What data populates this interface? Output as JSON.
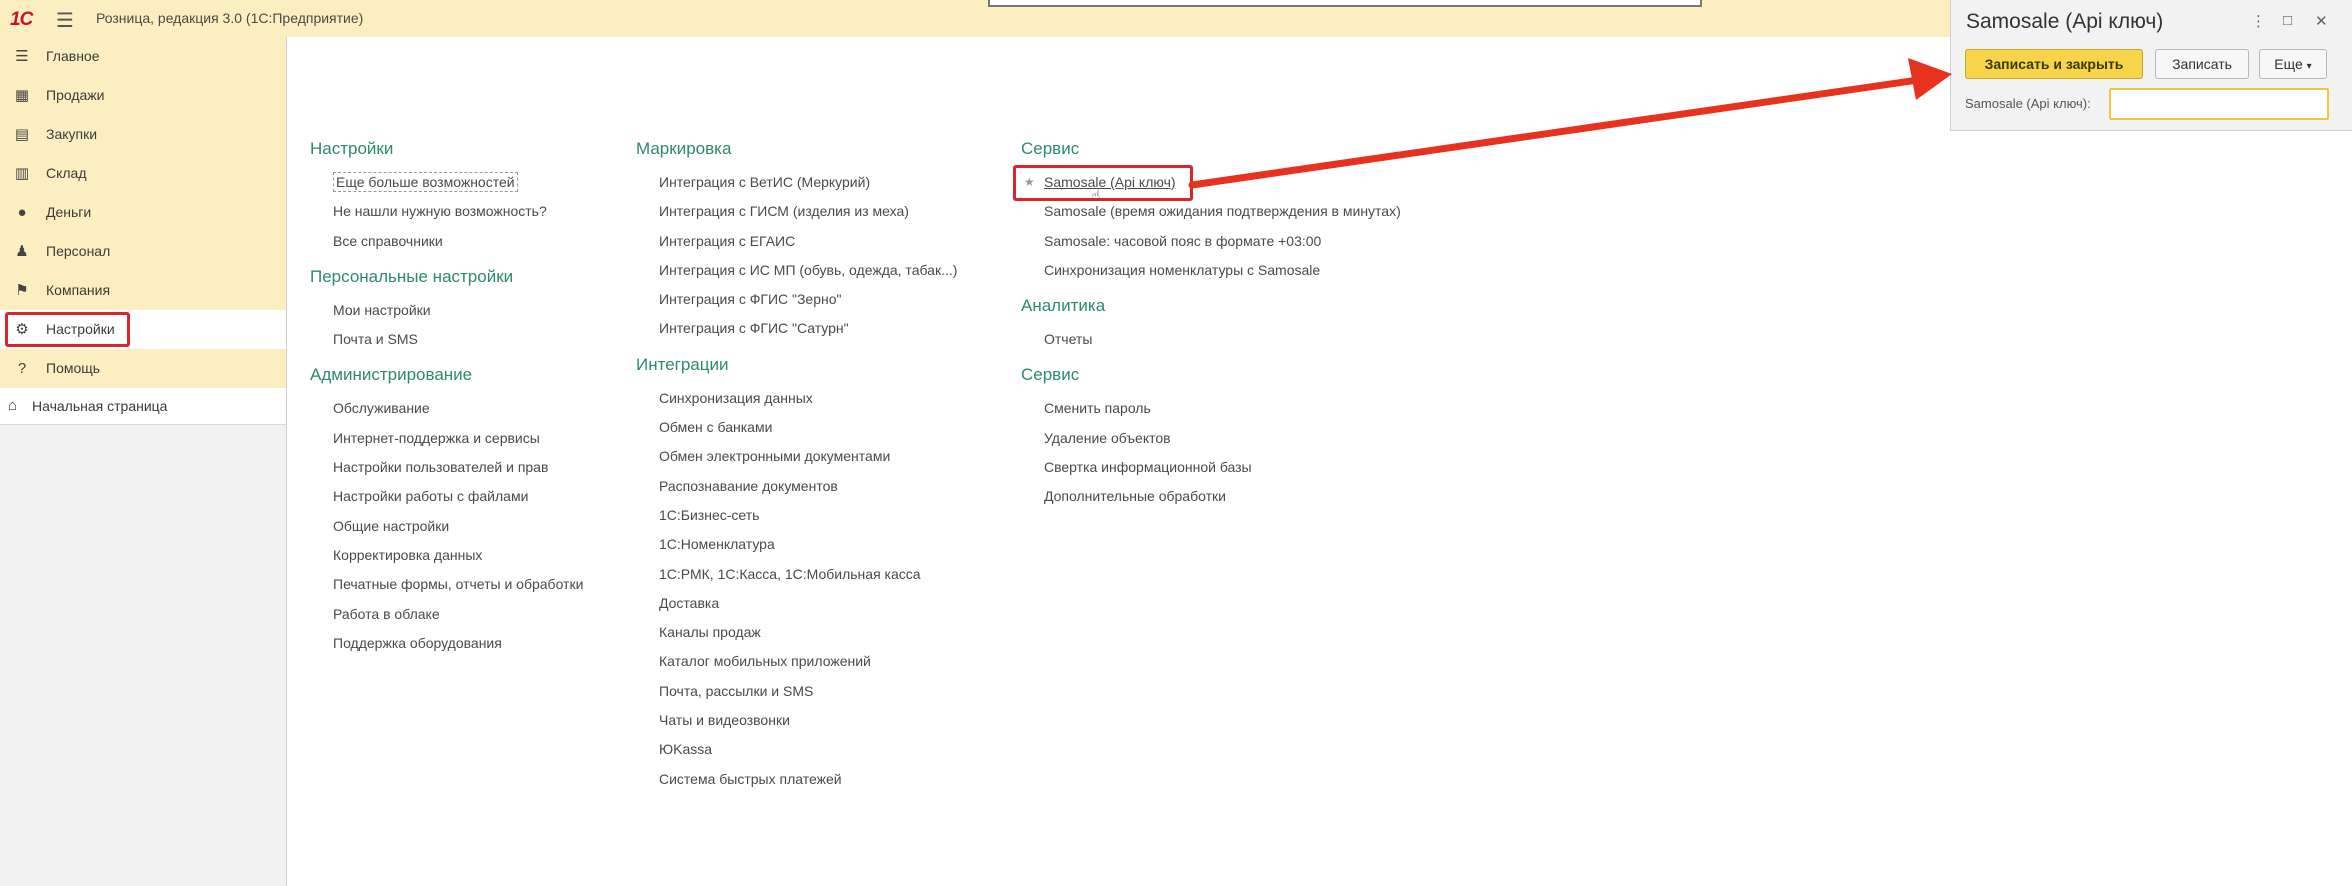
{
  "titlebar": {
    "logo": "1С",
    "menu_icon": "hamburger-icon",
    "title": "Розница, редакция 3.0  (1С:Предприятие)"
  },
  "sidebar": {
    "items": [
      {
        "label": "Главное",
        "icon": "list-icon"
      },
      {
        "label": "Продажи",
        "icon": "cash-register-icon"
      },
      {
        "label": "Закупки",
        "icon": "cart-icon"
      },
      {
        "label": "Склад",
        "icon": "warehouse-icon"
      },
      {
        "label": "Деньги",
        "icon": "coin-icon"
      },
      {
        "label": "Персонал",
        "icon": "people-icon"
      },
      {
        "label": "Компания",
        "icon": "flag-icon"
      },
      {
        "label": "Настройки",
        "icon": "gear-icon"
      },
      {
        "label": "Помощь",
        "icon": "help-icon"
      }
    ],
    "home": {
      "label": "Начальная страница",
      "icon": "home-icon"
    }
  },
  "main": {
    "col1": {
      "g1": {
        "title": "Настройки",
        "links": [
          "Еще больше возможностей",
          "Не нашли нужную возможность?",
          "Все справочники"
        ]
      },
      "g2": {
        "title": "Персональные настройки",
        "links": [
          "Мои настройки",
          "Почта и SMS"
        ]
      },
      "g3": {
        "title": "Администрирование",
        "links": [
          "Обслуживание",
          "Интернет-поддержка и сервисы",
          "Настройки пользователей и прав",
          "Настройки работы с файлами",
          "Общие настройки",
          "Корректировка данных",
          "Печатные формы, отчеты и обработки",
          "Работа в облаке",
          "Поддержка оборудования"
        ]
      }
    },
    "col2": {
      "g1": {
        "title": "Маркировка",
        "links": [
          "Интеграция с ВетИС (Меркурий)",
          "Интеграция с ГИСМ (изделия из меха)",
          "Интеграция с ЕГАИС",
          "Интеграция с ИС МП (обувь, одежда, табак...)",
          "Интеграция с ФГИС \"Зерно\"",
          "Интеграция с ФГИС \"Сатурн\""
        ]
      },
      "g2": {
        "title": "Интеграции",
        "links": [
          "Синхронизация данных",
          "Обмен с банками",
          "Обмен электронными документами",
          "Распознавание документов",
          "1С:Бизнес-сеть",
          "1С:Номенклатура",
          "1С:РМК, 1С:Касса, 1С:Мобильная касса",
          "Доставка",
          "Каналы продаж",
          "Каталог мобильных приложений",
          "Почта, рассылки и SMS",
          "Чаты и видеозвонки",
          "ЮKassa",
          "Система быстрых платежей"
        ]
      }
    },
    "col3": {
      "g1": {
        "title": "Сервис",
        "links": [
          "Samosale (Api ключ)",
          "Samosale (время ожидания подтверждения в минутах)",
          "Samosale: часовой пояс в формате +03:00",
          "Синхронизация номенклатуры с Samosale"
        ]
      },
      "g2": {
        "title": "Аналитика",
        "links": [
          "Отчеты"
        ]
      },
      "g3": {
        "title": "Сервис",
        "links": [
          "Сменить пароль",
          "Удаление объектов",
          "Свертка информационной базы",
          "Дополнительные обработки"
        ]
      }
    }
  },
  "dialog": {
    "title": "Samosale (Api ключ)",
    "save_close_label": "Записать и закрыть",
    "save_label": "Записать",
    "more_label": "Еще",
    "field_label": "Samosale (Api ключ):",
    "field_value": ""
  },
  "colors": {
    "accent": "#f7d44a",
    "highlight": "#d9262b",
    "group_title": "#2c8a6e",
    "titlebar": "#fbeec0"
  }
}
